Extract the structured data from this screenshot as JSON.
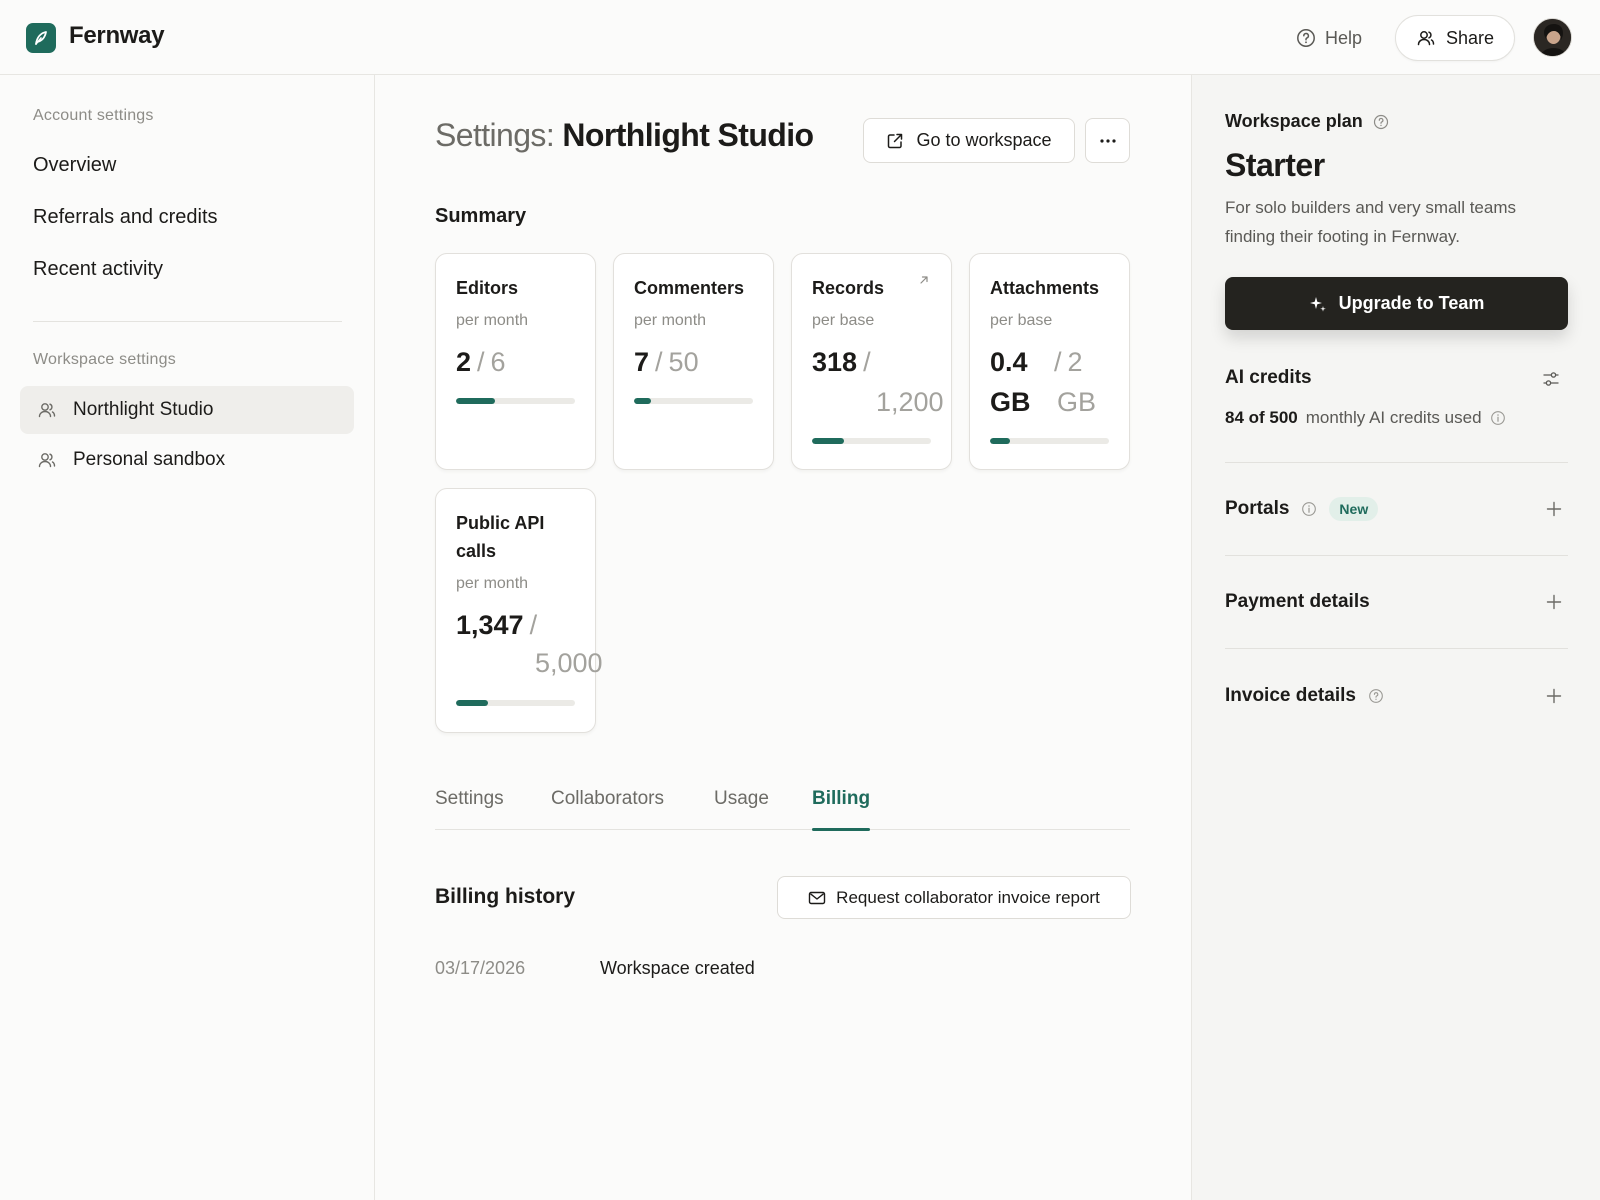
{
  "app": {
    "name": "Fernway"
  },
  "header": {
    "help_label": "Help",
    "share_label": "Share"
  },
  "sidebar": {
    "account_heading": "Account settings",
    "account_items": [
      {
        "label": "Overview"
      },
      {
        "label": "Referrals and credits"
      },
      {
        "label": "Recent activity"
      }
    ],
    "workspace_heading": "Workspace settings",
    "workspace_items": [
      {
        "label": "Northlight Studio",
        "active": true
      },
      {
        "label": "Personal sandbox",
        "active": false
      }
    ]
  },
  "main": {
    "title_prefix": "Settings:",
    "title_name": "Northlight Studio",
    "go_to_workspace_label": "Go to workspace",
    "summary_label": "Summary",
    "cards": [
      {
        "title": "Editors",
        "sub": "per month",
        "value": "2",
        "sep": "/",
        "limit": "6",
        "fraction": 0.33
      },
      {
        "title": "Commenters",
        "sub": "per month",
        "value": "7",
        "sep": "/",
        "limit": "50",
        "fraction": 0.14
      },
      {
        "title": "Records",
        "sub": "per base",
        "value": "318",
        "sep": "/",
        "limit": "1,200",
        "fraction": 0.265
      },
      {
        "title": "Attachments",
        "sub": "per base",
        "value": "0.4 GB",
        "value_num": "0.4",
        "value_unit": "GB",
        "sep": "/",
        "limit": "2 GB",
        "limit_num": "2",
        "limit_unit": "GB",
        "fraction": 0.17
      },
      {
        "title": "Public API calls",
        "sub": "per month",
        "value": "1,347",
        "sep": "/",
        "limit": "5,000",
        "fraction": 0.27
      }
    ],
    "tabs": [
      {
        "label": "Settings",
        "active": false
      },
      {
        "label": "Collaborators",
        "active": false
      },
      {
        "label": "Usage",
        "active": false
      },
      {
        "label": "Billing",
        "active": true
      }
    ],
    "billing": {
      "title": "Billing history",
      "report_button_label": "Request collaborator invoice report",
      "rows": [
        {
          "date": "03/17/2026",
          "description": "Workspace created"
        }
      ]
    }
  },
  "right_panel": {
    "plan_label": "Workspace plan",
    "plan_name": "Starter",
    "plan_description": "For solo builders and very small teams finding their footing in Fernway.",
    "upgrade_label": "Upgrade to Team",
    "ai_credits_title": "AI credits",
    "ai_credits_used": "84 of 500",
    "ai_credits_suffix": "monthly AI credits used",
    "sections": [
      {
        "label": "Portals",
        "badge": "New"
      },
      {
        "label": "Payment details"
      },
      {
        "label": "Invoice details"
      }
    ]
  },
  "colors": {
    "accent": "#1f6b5c",
    "dark_button": "#24231f",
    "badge_bg": "#e2efe9"
  }
}
